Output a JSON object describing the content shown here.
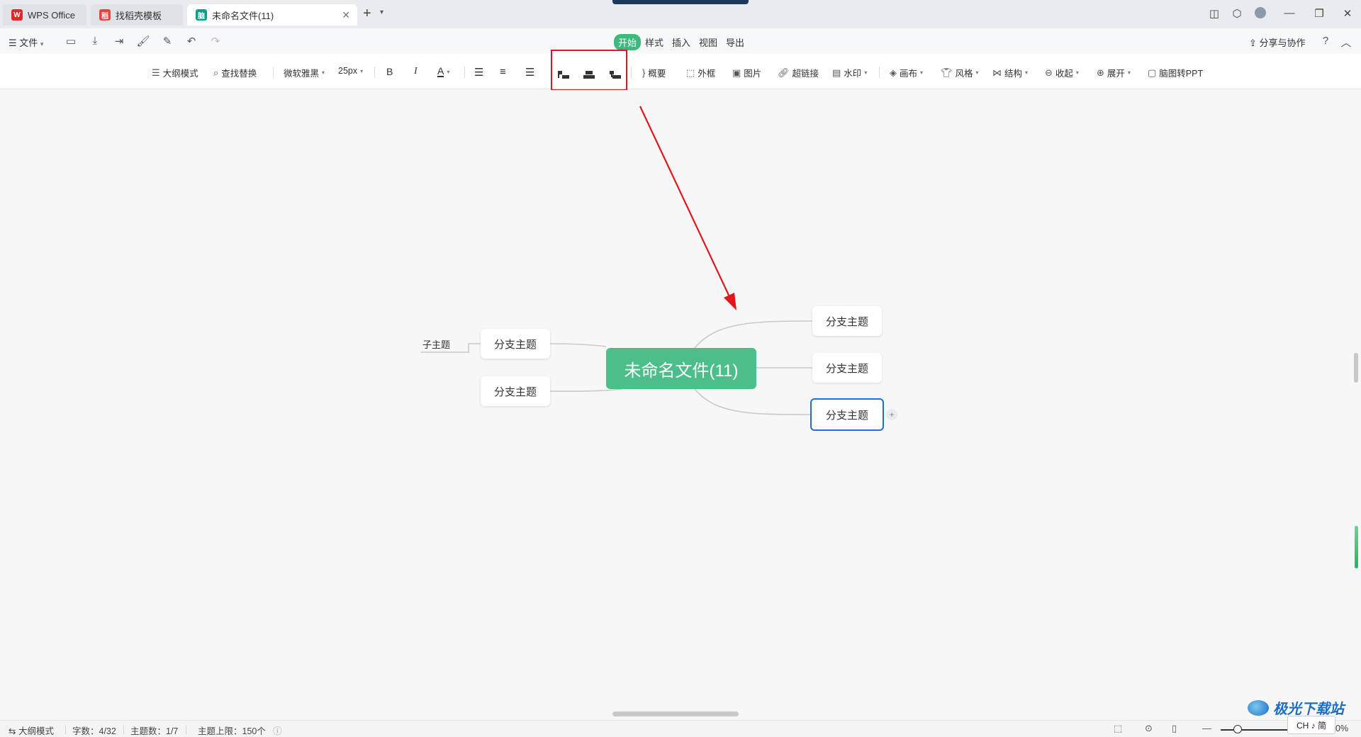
{
  "tabs": [
    {
      "label": "WPS Office",
      "icon": "wps-logo-icon"
    },
    {
      "label": "找稻壳模板",
      "icon": "docer-icon"
    },
    {
      "label": "未命名文件(11)",
      "icon": "mindmap-file-icon",
      "active": true
    }
  ],
  "menubar": {
    "file_label": "文件",
    "ribbon_tabs": [
      "开始",
      "样式",
      "插入",
      "视图",
      "导出"
    ],
    "active_tab": "开始",
    "share_label": "分享与协作"
  },
  "toolbar": {
    "outline_mode": "大纲模式",
    "find_replace": "查找替换",
    "font_name": "微软雅黑",
    "font_size": "25px",
    "bold": "B",
    "italic": "I",
    "font_color": "A",
    "summary": "概要",
    "frame": "外框",
    "image": "图片",
    "hyperlink": "超链接",
    "watermark": "水印",
    "canvas": "画布",
    "style": "风格",
    "structure": "结构",
    "collapse": "收起",
    "expand": "展开",
    "to_ppt": "脑图转PPT"
  },
  "mindmap": {
    "central_topic": "未命名文件(11)",
    "left_branches": [
      {
        "label": "分支主题",
        "subtopics": [
          "子主题"
        ]
      },
      {
        "label": "分支主题"
      }
    ],
    "right_branches": [
      {
        "label": "分支主题"
      },
      {
        "label": "分支主题"
      },
      {
        "label": "分支主题",
        "selected": true
      }
    ],
    "add_symbol": "+"
  },
  "statusbar": {
    "outline_mode": "大纲模式",
    "word_count": "字数：4/32",
    "topic_count": "主题数：1/7",
    "topic_limit": "主题上限：150个",
    "zoom_partial": "0%",
    "ime": "CH ♪ 简"
  },
  "watermark": {
    "text": "极光下载站"
  },
  "colors": {
    "central_topic": "#4cbe8a",
    "active_tab": "#3eb87d",
    "selection": "#1f6fe0",
    "annotation": "#e0171c"
  }
}
